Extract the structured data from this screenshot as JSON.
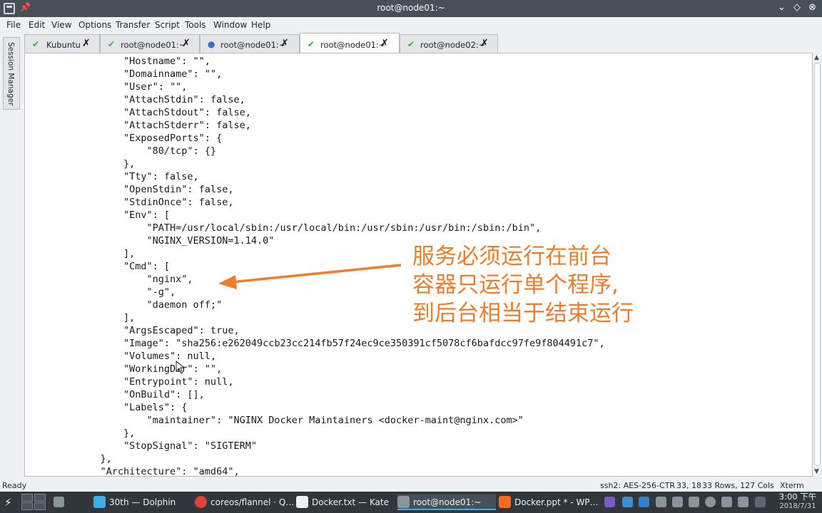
{
  "window": {
    "title": "root@node01:~",
    "controls": {
      "minimize": "⌄",
      "maximize": "◇",
      "close": "⊗"
    }
  },
  "menu": [
    "File",
    "Edit",
    "View",
    "Options",
    "Transfer",
    "Script",
    "Tools",
    "Window",
    "Help"
  ],
  "side_panel": {
    "label": "Session Manager"
  },
  "tabs": [
    {
      "label": "Kubuntu",
      "icon": "check-icon",
      "active": false
    },
    {
      "label": "root@node01:~",
      "icon": "check-icon",
      "active": false
    },
    {
      "label": "root@node01:~",
      "icon": "info-icon",
      "active": false
    },
    {
      "label": "root@node01:~",
      "icon": "check-icon",
      "active": true
    },
    {
      "label": "root@node02:~",
      "icon": "check-icon",
      "active": false
    }
  ],
  "terminal": {
    "lines": [
      "        \"Hostname\": \"\",",
      "        \"Domainname\": \"\",",
      "        \"User\": \"\",",
      "        \"AttachStdin\": false,",
      "        \"AttachStdout\": false,",
      "        \"AttachStderr\": false,",
      "        \"ExposedPorts\": {",
      "            \"80/tcp\": {}",
      "        },",
      "        \"Tty\": false,",
      "        \"OpenStdin\": false,",
      "        \"StdinOnce\": false,",
      "        \"Env\": [",
      "            \"PATH=/usr/local/sbin:/usr/local/bin:/usr/sbin:/usr/bin:/sbin:/bin\",",
      "            \"NGINX_VERSION=1.14.0\"",
      "        ],",
      "        \"Cmd\": [",
      "            \"nginx\",",
      "            \"-g\",",
      "            \"daemon off;\"",
      "        ],",
      "        \"ArgsEscaped\": true,",
      "        \"Image\": \"sha256:e262049ccb23cc214fb57f24ec9ce350391cf5078cf6bafdcc97fe9f804491c7\",",
      "        \"Volumes\": null,",
      "        \"WorkingDir\": \"\",",
      "        \"Entrypoint\": null,",
      "        \"OnBuild\": [],",
      "        \"Labels\": {",
      "            \"maintainer\": \"NGINX Docker Maintainers <docker-maint@nginx.com>\"",
      "        },",
      "        \"StopSignal\": \"SIGTERM\"",
      "    },",
      "    \"Architecture\": \"amd64\","
    ]
  },
  "annotation": {
    "lines": [
      "服务必须运行在前台",
      "容器只运行单个程序,",
      "到后台相当于结束运行"
    ],
    "color": "#ef7d2c"
  },
  "status": {
    "left": "Ready",
    "cipher": "ssh2: AES-256-CTR",
    "position": "33, 18",
    "size": "33 Rows, 127 Cols",
    "term": "Xterm"
  },
  "taskbar": {
    "tasks": [
      {
        "label": "30th — Dolphin",
        "icon": "folder-icon",
        "color": "#3daee9"
      },
      {
        "label": "coreos/flannel · Q…",
        "icon": "chrome-icon",
        "color": "#db4437"
      },
      {
        "label": "Docker.txt  — Kate",
        "icon": "document-icon",
        "color": "#eff0f1"
      },
      {
        "label": "root@node01:~",
        "icon": "terminal-icon",
        "color": "#8a949b",
        "active": true
      },
      {
        "label": "Docker.ppt * - WP…",
        "icon": "presentation-icon",
        "color": "#f46b20"
      }
    ],
    "clock": {
      "time": "3:00 下午",
      "date": "2018/7/31"
    }
  }
}
